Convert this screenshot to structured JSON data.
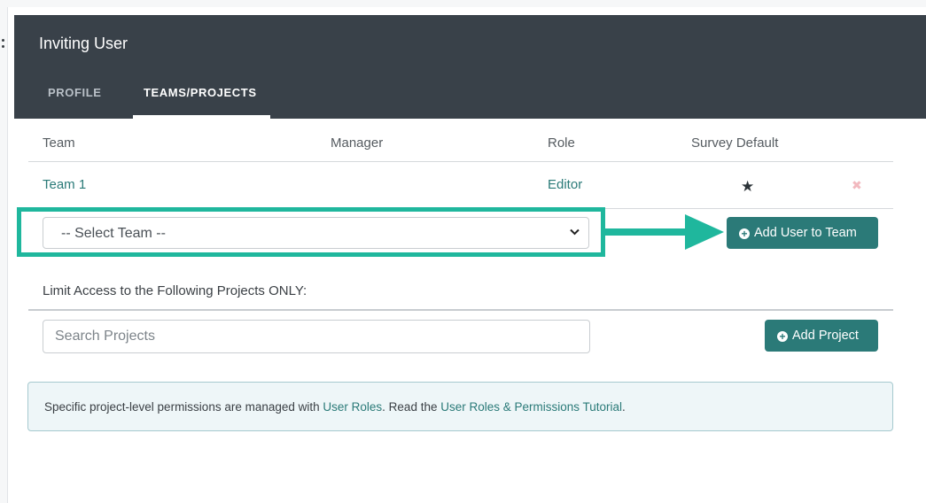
{
  "modal": {
    "title": "Inviting User",
    "tabs": [
      {
        "label": "PROFILE",
        "active": false
      },
      {
        "label": "TEAMS/PROJECTS",
        "active": true
      }
    ]
  },
  "teams_table": {
    "headers": [
      "Team",
      "Manager",
      "Role",
      "Survey Default"
    ],
    "rows": [
      {
        "team": "Team 1",
        "manager": "",
        "role": "Editor",
        "survey_default": true
      }
    ]
  },
  "team_select": {
    "selected": "-- Select Team --"
  },
  "add_team_button": {
    "label": "Add User to Team"
  },
  "projects": {
    "limit_label": "Limit Access to the Following Projects ONLY:",
    "search_placeholder": "Search Projects",
    "add_button": "Add Project"
  },
  "info": {
    "text_before": "Specific project-level permissions are managed with ",
    "link1": "User Roles",
    "text_middle": ". Read the ",
    "link2": "User Roles & Permissions Tutorial",
    "text_after": "."
  },
  "colors": {
    "header_bg": "#394149",
    "accent": "#2b7a78",
    "highlight": "#1fb79d"
  },
  "icons": [
    "star-icon",
    "remove-icon",
    "chevron-down-icon",
    "plus-circle-icon",
    "arrow-right-icon"
  ]
}
